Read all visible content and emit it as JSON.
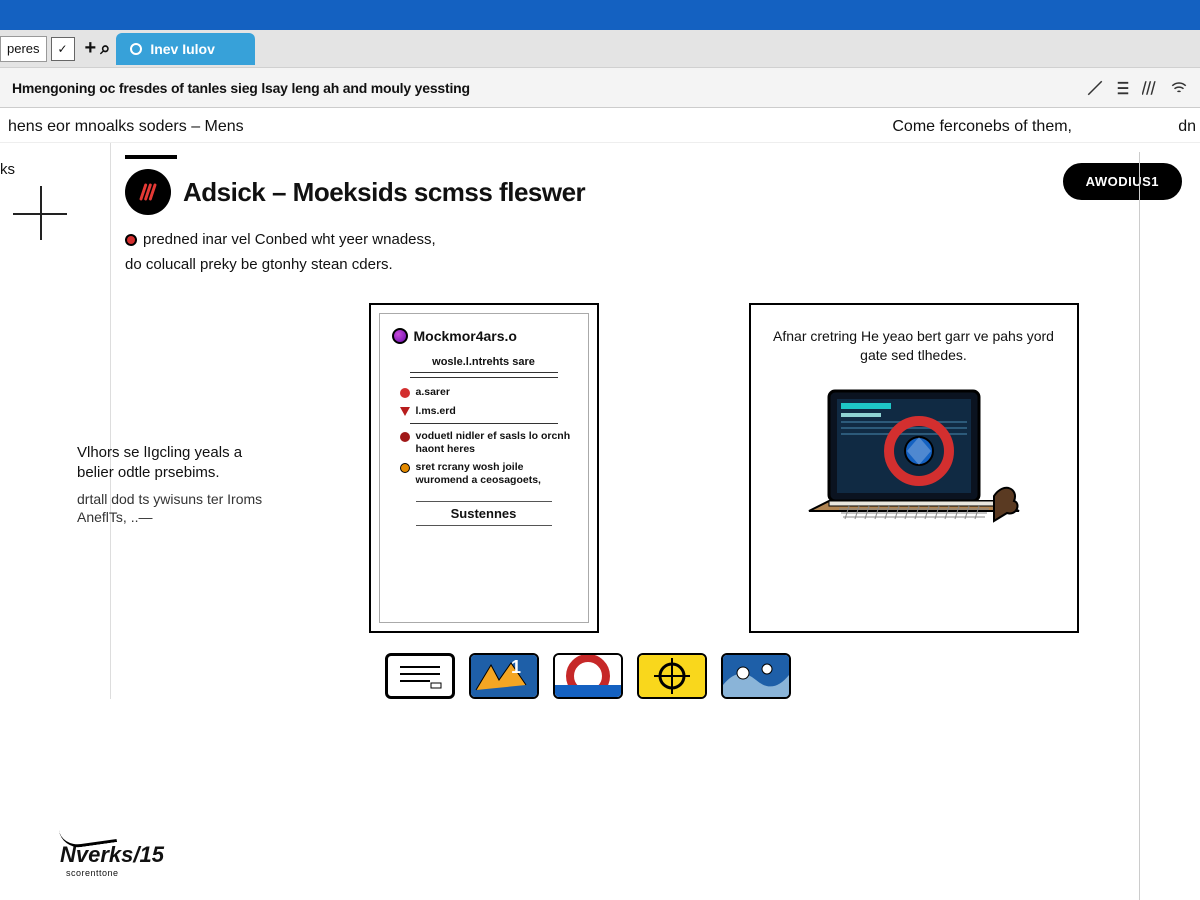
{
  "browser": {
    "select_label": "peres",
    "tab_label": "Inev Iulov",
    "addr_text": "Hmengoning oc fresdes of tanles sieg lsay leng ah and mouly yessting"
  },
  "breadcrumb": {
    "left": "hens eor mnoalks soders – Mens",
    "right": "Come ferconebs of them,",
    "far_right": "dn"
  },
  "sidebar": {
    "label": "ks"
  },
  "page": {
    "title": "Adsick – Moeksids scmss fleswer",
    "cta": "AWODIUS1",
    "bullet_line": "predned inar vel Conbed wht yeer wnadess,",
    "sub_line": "do colucall preky be gtonhy stean cders."
  },
  "sidebar_note": {
    "line1": "Vlhors se lIgcling yeals a belier odtle prsebims.",
    "line2": "drtall dod ts ywisuns ter Iroms AneflTs, ..—"
  },
  "card1": {
    "title": "Mockmor4ars.o",
    "subtitle": "wosle.l.ntrehts sare",
    "items": [
      "a.sarer",
      "l.ms.erd",
      "voduetl nidler ef sasls lo orcnh haont heres",
      "sret rcrany wosh joile wuromend a ceosagoets,"
    ],
    "button": "Sustennes"
  },
  "card2": {
    "text": "Afnar cretring He yeao bert garr ve pahs yord gate sed tlhedes."
  },
  "footer": {
    "brand": "Nverks/15",
    "sub": "scorenttone"
  }
}
